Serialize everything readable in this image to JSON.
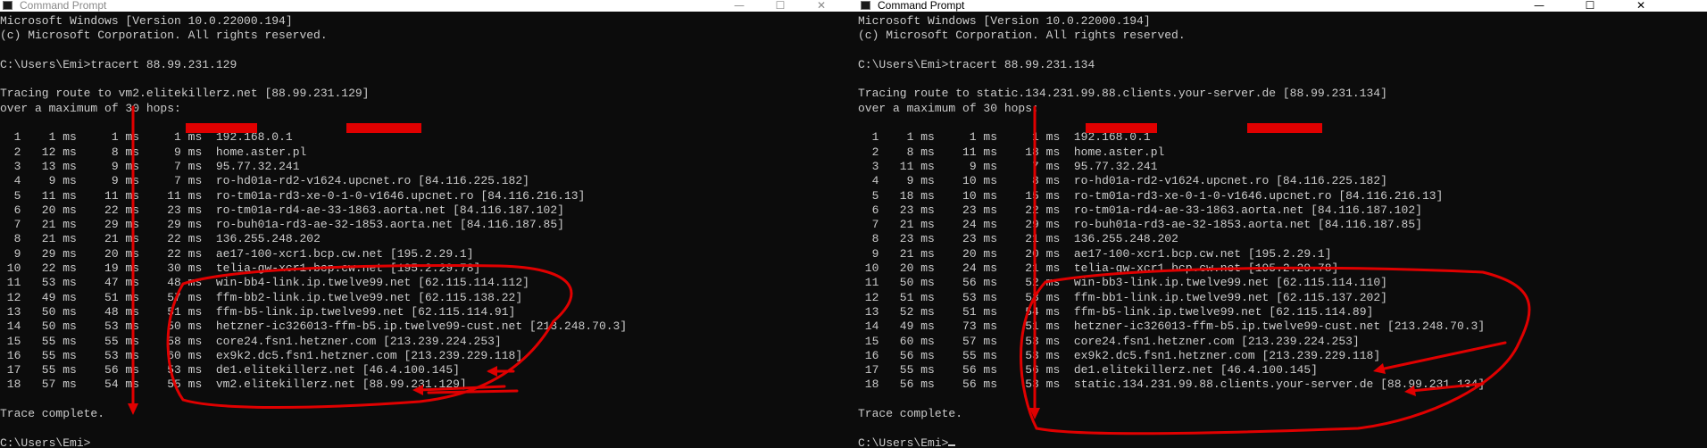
{
  "annotation_color": "#e00000",
  "windows": [
    {
      "title": "Command Prompt",
      "controls": {
        "minimize": "—",
        "maximize": "☐",
        "close": "✕"
      },
      "header": [
        "Microsoft Windows [Version 10.0.22000.194]",
        "(c) Microsoft Corporation. All rights reserved.",
        "",
        "C:\\Users\\Emi>tracert 88.99.231.129",
        "",
        "Tracing route to vm2.elitekillerz.net [88.99.231.129]",
        "over a maximum of 30 hops:",
        ""
      ],
      "hops": [
        [
          "1",
          "1 ms",
          "1 ms",
          "1 ms",
          "192.168.0.1"
        ],
        [
          "2",
          "12 ms",
          "8 ms",
          "9 ms",
          "home.aster.pl"
        ],
        [
          "3",
          "13 ms",
          "9 ms",
          "7 ms",
          "95.77.32.241"
        ],
        [
          "4",
          "9 ms",
          "9 ms",
          "7 ms",
          "ro-hd01a-rd2-v1624.upcnet.ro [84.116.225.182]"
        ],
        [
          "5",
          "11 ms",
          "11 ms",
          "11 ms",
          "ro-tm01a-rd3-xe-0-1-0-v1646.upcnet.ro [84.116.216.13]"
        ],
        [
          "6",
          "20 ms",
          "22 ms",
          "23 ms",
          "ro-tm01a-rd4-ae-33-1863.aorta.net [84.116.187.102]"
        ],
        [
          "7",
          "21 ms",
          "29 ms",
          "29 ms",
          "ro-buh01a-rd3-ae-32-1853.aorta.net [84.116.187.85]"
        ],
        [
          "8",
          "21 ms",
          "21 ms",
          "22 ms",
          "136.255.248.202"
        ],
        [
          "9",
          "29 ms",
          "20 ms",
          "22 ms",
          "ae17-100-xcr1.bcp.cw.net [195.2.29.1]"
        ],
        [
          "10",
          "22 ms",
          "19 ms",
          "30 ms",
          "telia-gw-xcr1.bcp.cw.net [195.2.29.78]"
        ],
        [
          "11",
          "53 ms",
          "47 ms",
          "48 ms",
          "win-bb4-link.ip.twelve99.net [62.115.114.112]"
        ],
        [
          "12",
          "49 ms",
          "51 ms",
          "57 ms",
          "ffm-bb2-link.ip.twelve99.net [62.115.138.22]"
        ],
        [
          "13",
          "50 ms",
          "48 ms",
          "51 ms",
          "ffm-b5-link.ip.twelve99.net [62.115.114.91]"
        ],
        [
          "14",
          "50 ms",
          "53 ms",
          "50 ms",
          "hetzner-ic326013-ffm-b5.ip.twelve99-cust.net [213.248.70.3]"
        ],
        [
          "15",
          "55 ms",
          "55 ms",
          "58 ms",
          "core24.fsn1.hetzner.com [213.239.224.253]"
        ],
        [
          "16",
          "55 ms",
          "53 ms",
          "60 ms",
          "ex9k2.dc5.fsn1.hetzner.com [213.239.229.118]"
        ],
        [
          "17",
          "55 ms",
          "56 ms",
          "53 ms",
          "de1.elitekillerz.net [46.4.100.145]"
        ],
        [
          "18",
          "57 ms",
          "54 ms",
          "55 ms",
          "vm2.elitekillerz.net [88.99.231.129]"
        ]
      ],
      "footer": [
        "",
        "Trace complete.",
        "",
        "C:\\Users\\Emi>"
      ]
    },
    {
      "title": "Command Prompt",
      "controls": {
        "minimize": "—",
        "maximize": "☐",
        "close": "✕"
      },
      "header": [
        "Microsoft Windows [Version 10.0.22000.194]",
        "(c) Microsoft Corporation. All rights reserved.",
        "",
        "C:\\Users\\Emi>tracert 88.99.231.134",
        "",
        "Tracing route to static.134.231.99.88.clients.your-server.de [88.99.231.134]",
        "over a maximum of 30 hops:",
        ""
      ],
      "hops": [
        [
          "1",
          "1 ms",
          "1 ms",
          "1 ms",
          "192.168.0.1"
        ],
        [
          "2",
          "8 ms",
          "11 ms",
          "18 ms",
          "home.aster.pl"
        ],
        [
          "3",
          "11 ms",
          "9 ms",
          "7 ms",
          "95.77.32.241"
        ],
        [
          "4",
          "9 ms",
          "10 ms",
          "8 ms",
          "ro-hd01a-rd2-v1624.upcnet.ro [84.116.225.182]"
        ],
        [
          "5",
          "18 ms",
          "10 ms",
          "15 ms",
          "ro-tm01a-rd3-xe-0-1-0-v1646.upcnet.ro [84.116.216.13]"
        ],
        [
          "6",
          "23 ms",
          "23 ms",
          "22 ms",
          "ro-tm01a-rd4-ae-33-1863.aorta.net [84.116.187.102]"
        ],
        [
          "7",
          "21 ms",
          "24 ms",
          "29 ms",
          "ro-buh01a-rd3-ae-32-1853.aorta.net [84.116.187.85]"
        ],
        [
          "8",
          "23 ms",
          "23 ms",
          "21 ms",
          "136.255.248.202"
        ],
        [
          "9",
          "21 ms",
          "20 ms",
          "20 ms",
          "ae17-100-xcr1.bcp.cw.net [195.2.29.1]"
        ],
        [
          "10",
          "20 ms",
          "24 ms",
          "21 ms",
          "telia-gw-xcr1.bcp.cw.net [195.2.29.78]"
        ],
        [
          "11",
          "50 ms",
          "56 ms",
          "52 ms",
          "win-bb3-link.ip.twelve99.net [62.115.114.110]"
        ],
        [
          "12",
          "51 ms",
          "53 ms",
          "53 ms",
          "ffm-bb1-link.ip.twelve99.net [62.115.137.202]"
        ],
        [
          "13",
          "52 ms",
          "51 ms",
          "54 ms",
          "ffm-b5-link.ip.twelve99.net [62.115.114.89]"
        ],
        [
          "14",
          "49 ms",
          "73 ms",
          "51 ms",
          "hetzner-ic326013-ffm-b5.ip.twelve99-cust.net [213.248.70.3]"
        ],
        [
          "15",
          "60 ms",
          "57 ms",
          "53 ms",
          "core24.fsn1.hetzner.com [213.239.224.253]"
        ],
        [
          "16",
          "56 ms",
          "55 ms",
          "53 ms",
          "ex9k2.dc5.fsn1.hetzner.com [213.239.229.118]"
        ],
        [
          "17",
          "55 ms",
          "56 ms",
          "56 ms",
          "de1.elitekillerz.net [46.4.100.145]"
        ],
        [
          "18",
          "56 ms",
          "56 ms",
          "53 ms",
          "static.134.231.99.88.clients.your-server.de [88.99.231.134]"
        ]
      ],
      "footer": [
        "",
        "Trace complete.",
        "",
        "C:\\Users\\Emi>"
      ]
    }
  ]
}
